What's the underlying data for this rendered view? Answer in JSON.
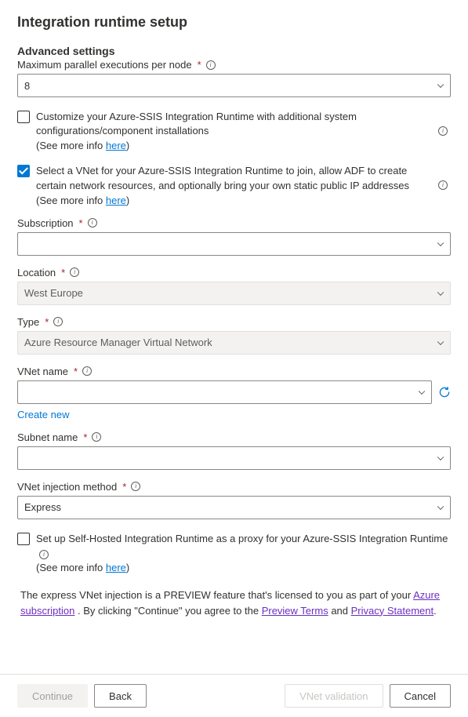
{
  "page": {
    "title": "Integration runtime setup",
    "section": "Advanced settings"
  },
  "fields": {
    "maxParallel": {
      "label": "Maximum parallel executions per node",
      "value": "8"
    },
    "customize": {
      "text": "Customize your Azure-SSIS Integration Runtime with additional system configurations/component installations",
      "checked": false,
      "seeMorePrefix": "(See more info ",
      "seeMoreLink": "here",
      "seeMoreSuffix": ")"
    },
    "vnetSelect": {
      "text": "Select a VNet for your Azure-SSIS Integration Runtime to join, allow ADF to create certain network resources, and optionally bring your own static public IP addresses",
      "checked": true,
      "seeMorePrefix": "(See more info ",
      "seeMoreLink": "here",
      "seeMoreSuffix": ")"
    },
    "subscription": {
      "label": "Subscription",
      "value": ""
    },
    "location": {
      "label": "Location",
      "value": "West Europe"
    },
    "type": {
      "label": "Type",
      "value": "Azure Resource Manager Virtual Network"
    },
    "vnetName": {
      "label": "VNet name",
      "value": "",
      "createNew": "Create new"
    },
    "subnetName": {
      "label": "Subnet name",
      "value": ""
    },
    "injection": {
      "label": "VNet injection method",
      "value": "Express"
    },
    "proxy": {
      "text": "Set up Self-Hosted Integration Runtime as a proxy for your Azure-SSIS Integration Runtime",
      "checked": false,
      "seeMorePrefix": "(See more info ",
      "seeMoreLink": "here",
      "seeMoreSuffix": ")"
    }
  },
  "preview": {
    "part1": "The express VNet injection is a PREVIEW feature that's licensed to you as part of your ",
    "link1": "Azure subscription",
    "part2": " . By clicking \"Continue\" you agree to the ",
    "link2": "Preview Terms",
    "part3": " and ",
    "link3": "Privacy Statement",
    "part4": "."
  },
  "footer": {
    "continue": "Continue",
    "back": "Back",
    "validation": "VNet validation",
    "cancel": "Cancel"
  }
}
